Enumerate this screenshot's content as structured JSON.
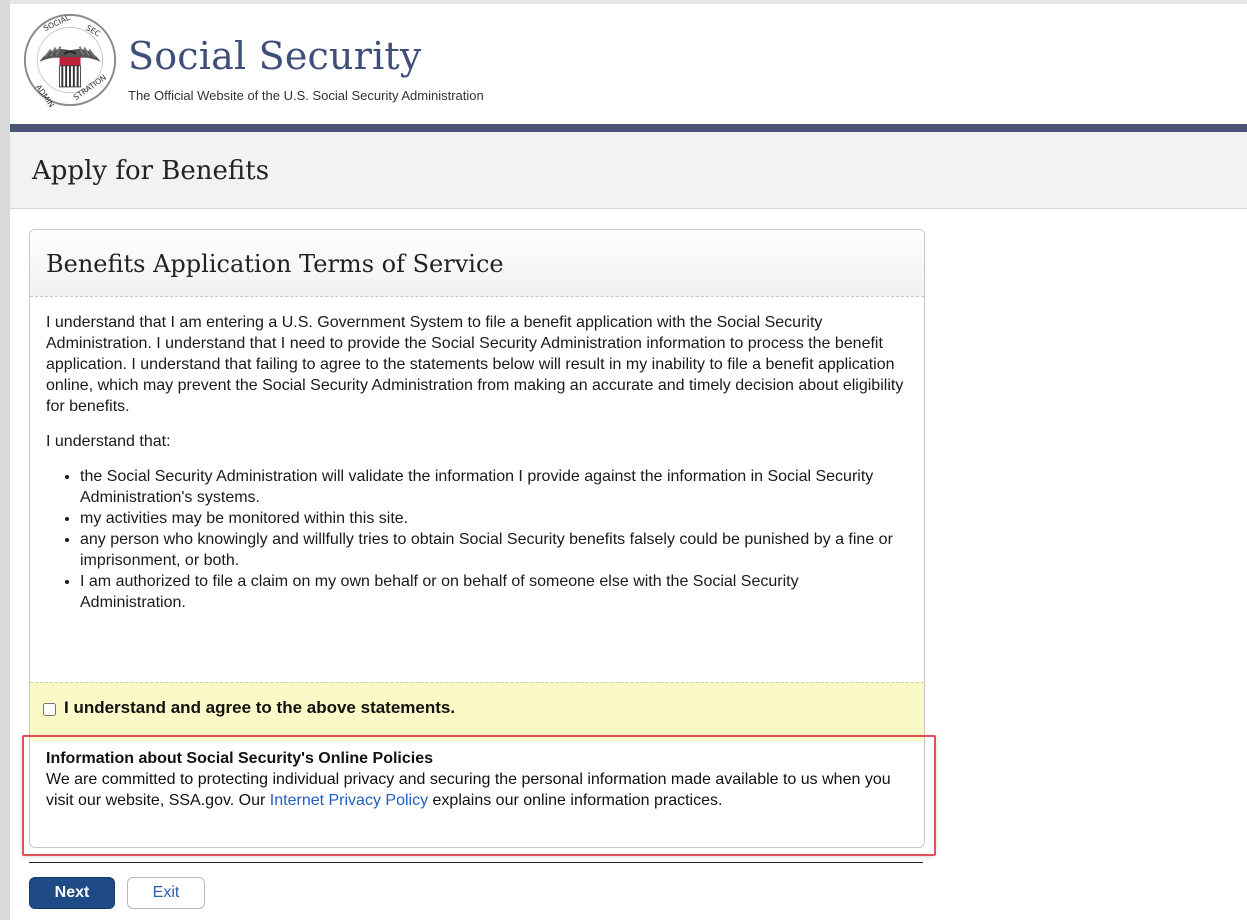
{
  "header": {
    "title": "Social Security",
    "subtitle": "The Official Website of the U.S. Social Security Administration",
    "logo_icon": "ssa-seal-icon",
    "logo_text": "SOCIAL SECURITY ADMINISTRATION USA"
  },
  "page": {
    "title": "Apply for Benefits"
  },
  "terms": {
    "title": "Benefits Application Terms of Service",
    "intro": "I understand that I am entering a U.S. Government System to file a benefit application with the Social Security Administration. I understand that I need to provide the Social Security Administration information to process the benefit application. I understand that failing to agree to the statements below will result in my inability to file a benefit application online, which may prevent the Social Security Administration from making an accurate and timely decision about eligibility for benefits.",
    "understand_that": "I understand that:",
    "items": [
      "the Social Security Administration will validate the information I provide against the information in Social Security Administration's systems.",
      "my activities may be monitored within this site.",
      "any person who knowingly and willfully tries to obtain Social Security benefits falsely could be punished by a fine or imprisonment, or both.",
      "I am authorized to file a claim on my own behalf or on behalf of someone else with the Social Security Administration."
    ],
    "agree_label": "I understand and agree to the above statements.",
    "agree_checked": false
  },
  "policy": {
    "heading": "Information about Social Security's Online Policies",
    "text_before": "We are committed to protecting individual privacy and securing the personal information made available to us when you visit our website, SSA.gov. Our ",
    "link_text": "Internet Privacy Policy",
    "text_after": " explains our online information practices."
  },
  "actions": {
    "next_label": "Next",
    "exit_label": "Exit"
  },
  "colors": {
    "brand_navy": "#3f4f7a",
    "nav_bar": "#4a5578",
    "agree_band": "#fbf9c5",
    "link": "#1f5fbf",
    "primary_button": "#1e4b86",
    "highlight": "#e0525a"
  }
}
